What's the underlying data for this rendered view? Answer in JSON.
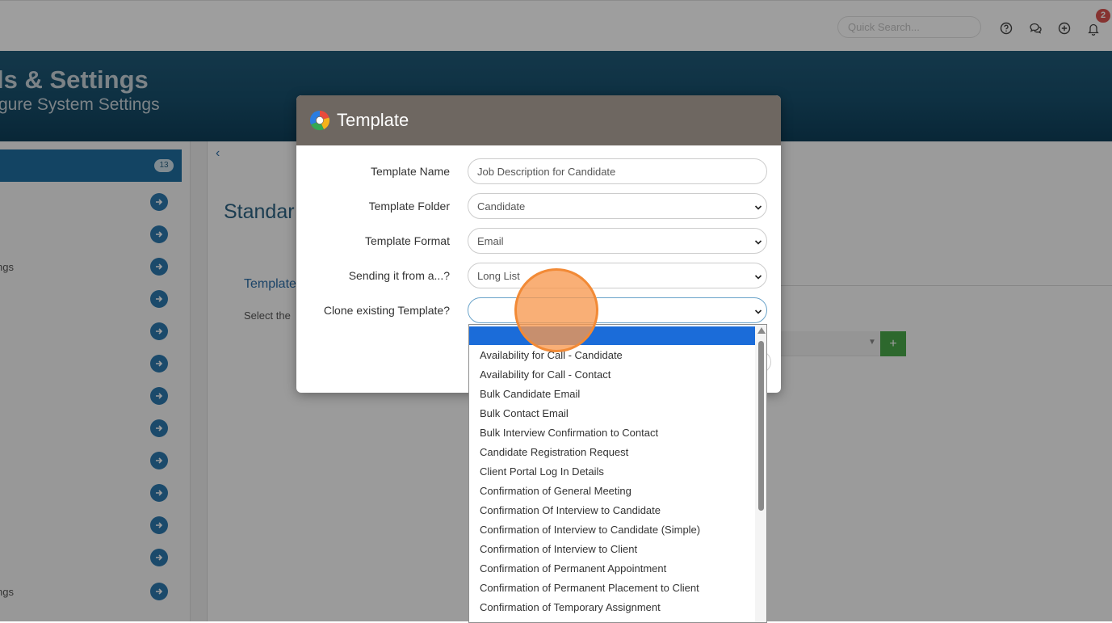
{
  "topbar": {
    "search_placeholder": "Quick Search...",
    "notification_count": "2",
    "icons": [
      "help-icon",
      "chat-icon",
      "add-icon",
      "bell-icon"
    ]
  },
  "hero": {
    "title": "ls & Settings",
    "subtitle": "gure System Settings"
  },
  "left_panel": {
    "count": "13",
    "items": [
      {
        "label": ""
      },
      {
        "label": ""
      },
      {
        "label": "ngs"
      },
      {
        "label": ""
      },
      {
        "label": ""
      },
      {
        "label": ""
      },
      {
        "label": ""
      },
      {
        "label": ""
      },
      {
        "label": ""
      },
      {
        "label": ""
      },
      {
        "label": ""
      },
      {
        "label": ""
      },
      {
        "label": "ngs"
      }
    ]
  },
  "main_panel": {
    "back": "‹",
    "title": "Standar",
    "section": "Template",
    "select_text": "Select the",
    "add": "+"
  },
  "modal": {
    "title": "Template",
    "fields": {
      "template_name": {
        "label": "Template Name",
        "value": "Job Description for Candidate"
      },
      "template_folder": {
        "label": "Template Folder",
        "value": "Candidate"
      },
      "template_format": {
        "label": "Template Format",
        "value": "Email"
      },
      "sending_from": {
        "label": "Sending it from a...?",
        "value": "Long List"
      },
      "clone_existing": {
        "label": "Clone existing Template?",
        "value": ""
      }
    }
  },
  "dropdown": {
    "options": [
      "Availability for Call - Candidate",
      "Availability for Call - Contact",
      "Bulk Candidate Email",
      "Bulk Contact Email",
      "Bulk Interview Confirmation to Contact",
      "Candidate Registration Request",
      "Client Portal Log In Details",
      "Confirmation of General Meeting",
      "Confirmation Of Interview to Candidate",
      "Confirmation of Interview to Candidate (Simple)",
      "Confirmation of Interview to Client",
      "Confirmation of Permanent Appointment",
      "Confirmation of Permanent Placement to Client",
      "Confirmation of Temporary Assignment"
    ]
  },
  "colors": {
    "accent": "#1f6fa0",
    "modal_header": "#6e6761",
    "selected_option": "#1b6cd9",
    "badge": "#d9534f",
    "cursor": "#f28a36"
  }
}
